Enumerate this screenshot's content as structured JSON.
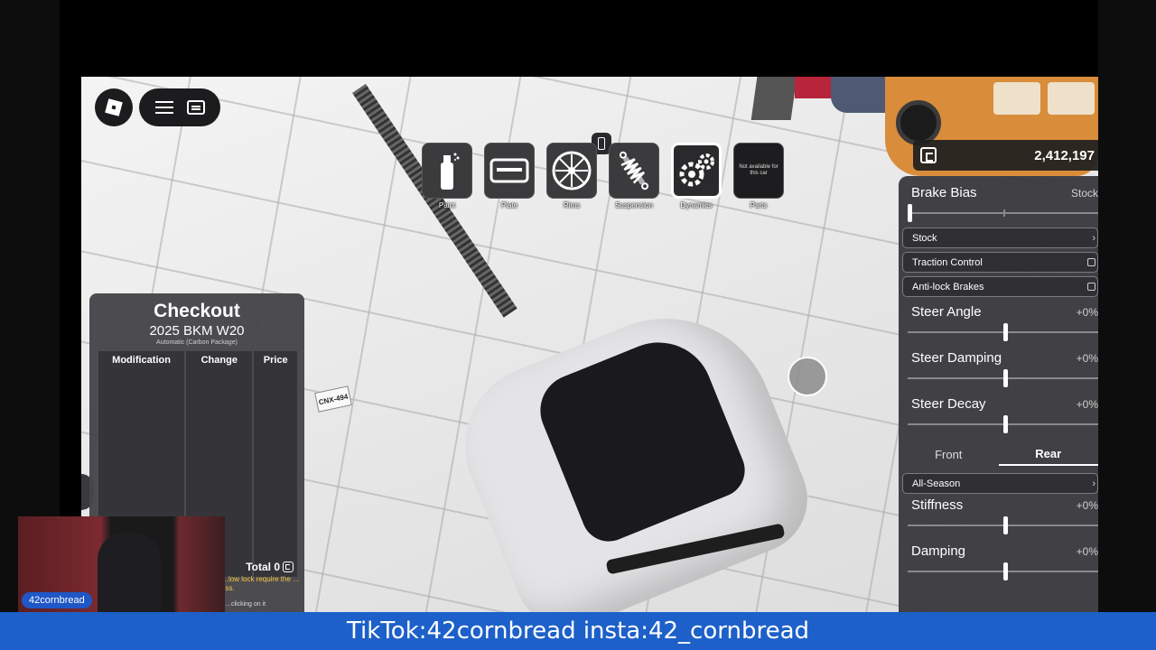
{
  "toolbar": {
    "items": [
      {
        "label": "Paint",
        "icon": "spray-can-icon"
      },
      {
        "label": "Plate",
        "icon": "license-plate-icon"
      },
      {
        "label": "Rims",
        "icon": "rim-icon"
      },
      {
        "label": "Suspension",
        "icon": "shock-absorber-icon"
      },
      {
        "label": "Dynamics",
        "icon": "gears-icon",
        "active": true
      },
      {
        "label": "Parts",
        "icon": "engine-icon",
        "note": "Not available for this car"
      }
    ]
  },
  "balance": {
    "value": "2,412,197"
  },
  "tune": {
    "brake_bias": {
      "title": "Brake Bias",
      "value": "Stock",
      "level": 0.0
    },
    "brake_mode": {
      "selected": "Stock"
    },
    "traction_control": {
      "label": "Traction Control"
    },
    "abs": {
      "label": "Anti-lock Brakes"
    },
    "steer_angle": {
      "title": "Steer Angle",
      "value": "+0%",
      "level": 0.5
    },
    "steer_damping": {
      "title": "Steer Damping",
      "value": "+0%",
      "level": 0.5
    },
    "steer_decay": {
      "title": "Steer Decay",
      "value": "+0%",
      "level": 0.5
    },
    "axle_tabs": {
      "front": "Front",
      "rear": "Rear",
      "selected": "Rear"
    },
    "tire": {
      "selected": "All-Season"
    },
    "stiffness": {
      "title": "Stiffness",
      "value": "+0%",
      "level": 0.5
    },
    "damping": {
      "title": "Damping",
      "value": "+0%",
      "level": 0.5
    }
  },
  "checkout": {
    "title": "Checkout",
    "car": "2025 BKM W20",
    "subtitle": "Automatic (Carbon Package)",
    "columns": [
      "Modification",
      "Change",
      "Price"
    ],
    "total_label": "Total 0",
    "warning": "…low lock require the …ess.",
    "hint": "…clicking on it"
  },
  "car": {
    "plate": "CNX-494"
  },
  "stream": {
    "streamer": "42cornbread",
    "banner": "TikTok:42cornbread insta:42_cornbread"
  },
  "colors": {
    "banner": "#1d60c9",
    "panel": "#3a3a3e",
    "accent_red": "#b8243a"
  }
}
